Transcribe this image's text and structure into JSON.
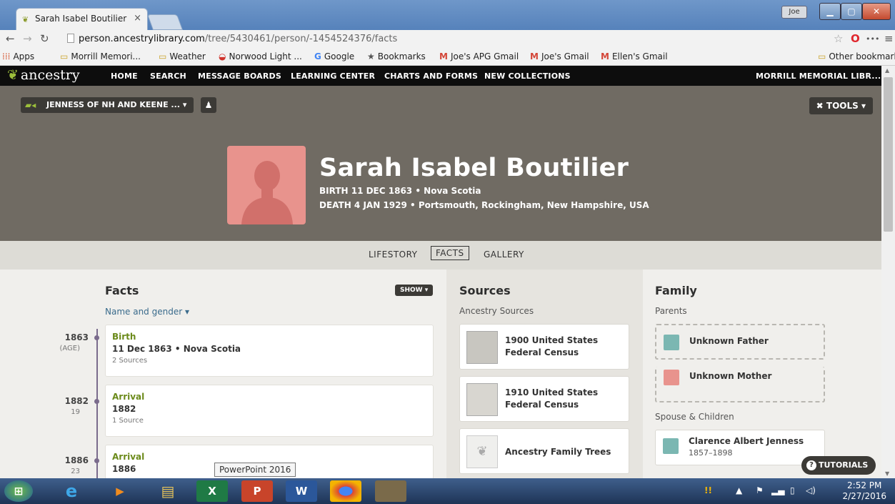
{
  "browser": {
    "tab_title": "Sarah Isabel Boutilier",
    "tab_close": "×",
    "user_badge": "Joe",
    "url_host": "person.ancestrylibrary.com",
    "url_path": "/tree/5430461/person/-1454524376/facts"
  },
  "bookmarks": [
    {
      "icon": "apps-icon",
      "label": "Apps"
    },
    {
      "icon": "folder-icon",
      "label": "Morrill Memori..."
    },
    {
      "icon": "folder-icon",
      "label": "Weather"
    },
    {
      "icon": "boat-icon",
      "label": "Norwood Light ..."
    },
    {
      "icon": "google-icon",
      "label": "Google"
    },
    {
      "icon": "star-icon",
      "label": "Bookmarks"
    },
    {
      "icon": "gmail-icon",
      "label": "Joe's APG Gmail"
    },
    {
      "icon": "gmail-icon",
      "label": "Joe's Gmail"
    },
    {
      "icon": "gmail-icon",
      "label": "Ellen's Gmail"
    },
    {
      "icon": "folder-icon",
      "label": "Other bookmarks"
    }
  ],
  "nav": {
    "logo": "ancestry",
    "links": [
      "HOME",
      "SEARCH",
      "MESSAGE BOARDS",
      "LEARNING CENTER",
      "CHARTS AND FORMS",
      "NEW COLLECTIONS"
    ],
    "library": "MORRILL MEMORIAL LIBR..."
  },
  "header": {
    "tree_name": "JENNESS OF NH AND KEENE ...",
    "tools": "TOOLS",
    "person_name": "Sarah Isabel Boutilier",
    "birth": "BIRTH  11 DEC 1863 • Nova Scotia",
    "death": "DEATH  4 JAN 1929 • Portsmouth, Rockingham, New Hampshire, USA"
  },
  "subnav": [
    "LIFESTORY",
    "FACTS",
    "GALLERY"
  ],
  "facts": {
    "title": "Facts",
    "show": "SHOW",
    "filter": "Name and gender",
    "items": [
      {
        "year": "1863",
        "age": "(AGE)",
        "title": "Birth",
        "date": "11 Dec 1863 • Nova Scotia",
        "sources": "2 Sources"
      },
      {
        "year": "1882",
        "age": "19",
        "title": "Arrival",
        "date": "1882",
        "sources": "1 Source"
      },
      {
        "year": "1886",
        "age": "23",
        "title": "Arrival",
        "date": "1886",
        "sources": ""
      }
    ]
  },
  "sources": {
    "title": "Sources",
    "subtitle": "Ancestry Sources",
    "items": [
      "1900 United States Federal Census",
      "1910 United States Federal Census",
      "Ancestry Family Trees"
    ]
  },
  "family": {
    "title": "Family",
    "parents_label": "Parents",
    "father": "Unknown Father",
    "mother": "Unknown Mother",
    "spouse_label": "Spouse & Children",
    "spouse_name": "Clarence Albert Jenness",
    "spouse_dates": "1857–1898"
  },
  "tutorials": "TUTORIALS",
  "tooltip": "PowerPoint 2016",
  "clock": {
    "time": "2:52 PM",
    "date": "2/27/2016"
  },
  "colors": {
    "ancestry_green": "#9cbf3b",
    "header_bg": "#706b63",
    "female_avatar": "#e8938d",
    "male_avatar": "#7bb7b2"
  }
}
